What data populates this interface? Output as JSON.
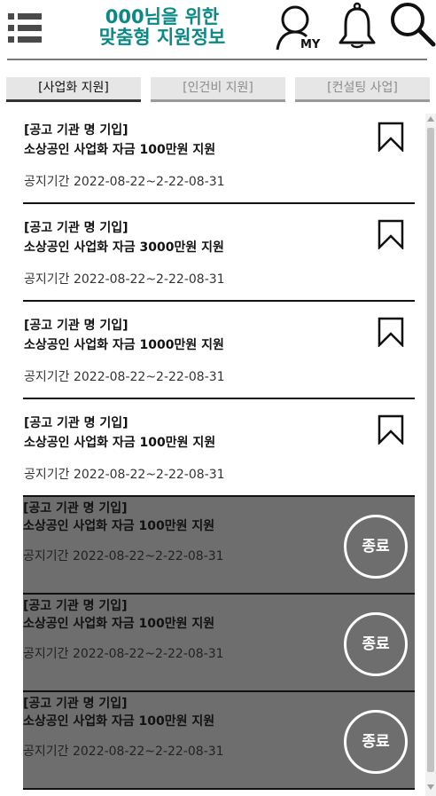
{
  "header": {
    "title_line1": "000님을 위한",
    "title_line2": "맞춤형 지원정보",
    "my_label": "MY",
    "icons": [
      "menu-icon",
      "my-page-icon",
      "bell-icon",
      "search-icon"
    ]
  },
  "tabs": [
    {
      "label": "[사업화 지원]",
      "active": true
    },
    {
      "label": "[인건비 지원]",
      "active": false
    },
    {
      "label": "[컨설팅 사업]",
      "active": false
    }
  ],
  "listings": [
    {
      "org": "[공고 기관 명 기입]",
      "name": "소상공인 사업화 자금 100만원 지원",
      "period": "공지기간 2022-08-22~2-22-08-31",
      "status": "open"
    },
    {
      "org": "[공고 기관 명 기입]",
      "name": "소상공인 사업화 자금 3000만원 지원",
      "period": "공지기간 2022-08-22~2-22-08-31",
      "status": "open"
    },
    {
      "org": "[공고 기관 명 기입]",
      "name": "소상공인 사업화 자금 1000만원 지원",
      "period": "공지기간 2022-08-22~2-22-08-31",
      "status": "open"
    },
    {
      "org": "[공고 기관 명 기입]",
      "name": "소상공인 사업화 자금 100만원 지원",
      "period": "공지기간 2022-08-22~2-22-08-31",
      "status": "open"
    },
    {
      "org": "[공고 기관 명 기입]",
      "name": "소상공인 사업화 자금 100만원 지원",
      "period": "공지기간 2022-08-22~2-22-08-31",
      "status": "ended",
      "badge": "종료"
    },
    {
      "org": "[공고 기관 명 기입]",
      "name": "소상공인 사업화 자금 100만원 지원",
      "period": "공지기간 2022-08-22~2-22-08-31",
      "status": "ended",
      "badge": "종료"
    },
    {
      "org": "[공고 기관 명 기입]",
      "name": "소상공인 사업화 자금 100만원 지원",
      "period": "공지기간 2022-08-22~2-22-08-31",
      "status": "ended",
      "badge": "종료"
    }
  ],
  "colors": {
    "title": "#0a8a86",
    "ended_background": "#6e6e6e",
    "tab_background": "#e6e6e6"
  }
}
